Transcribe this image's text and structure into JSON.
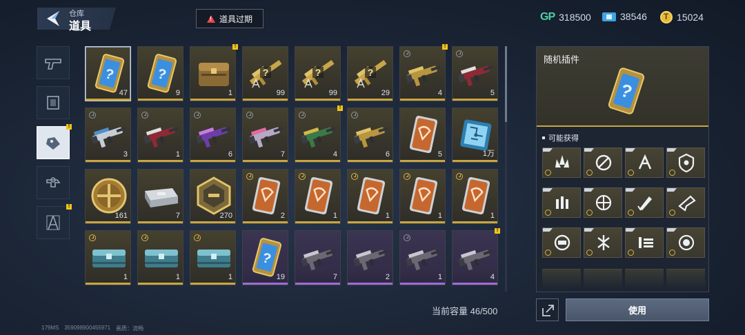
{
  "header": {
    "subtitle": "仓库",
    "title": "道具",
    "expire_label": "道具过期"
  },
  "currency": [
    {
      "icon": "gp-icon",
      "label": "GP",
      "value": "318500"
    },
    {
      "icon": "ticket-icon",
      "value": "38546"
    },
    {
      "icon": "coin-icon",
      "value": "15024"
    }
  ],
  "categories": [
    {
      "name": "weapons",
      "icon": "pistol-icon",
      "active": false,
      "badge": false
    },
    {
      "name": "frames",
      "icon": "frame-icon",
      "active": false,
      "badge": false
    },
    {
      "name": "items",
      "icon": "tag-icon",
      "active": true,
      "badge": true
    },
    {
      "name": "gear",
      "icon": "gear-icon",
      "active": false,
      "badge": false
    },
    {
      "name": "blueprints",
      "icon": "compass-icon",
      "active": false,
      "badge": true
    }
  ],
  "items": [
    {
      "type": "card-question",
      "count": "47",
      "style": "gold",
      "selected": true
    },
    {
      "type": "card-question",
      "count": "9",
      "style": "gold"
    },
    {
      "type": "crate-gold",
      "count": "1",
      "style": "gold",
      "badge": true
    },
    {
      "type": "blueprint-gold",
      "count": "99",
      "style": "gold"
    },
    {
      "type": "blueprint-gold",
      "count": "99",
      "style": "gold"
    },
    {
      "type": "blueprint-gold",
      "count": "29",
      "style": "gold"
    },
    {
      "type": "rifle-gold",
      "count": "4",
      "style": "gold",
      "badge": true,
      "clock": "dim"
    },
    {
      "type": "rifle-red",
      "count": "5",
      "style": "gold",
      "clock": "dim"
    },
    {
      "type": "rifle-white",
      "count": "3",
      "style": "gold",
      "clock": "dim"
    },
    {
      "type": "rifle-red",
      "count": "1",
      "style": "gold",
      "clock": "dim"
    },
    {
      "type": "rifle-purple",
      "count": "6",
      "style": "gold",
      "clock": "dim"
    },
    {
      "type": "rifle-pink",
      "count": "7",
      "style": "gold",
      "clock": "dim"
    },
    {
      "type": "rifle-green",
      "count": "4",
      "style": "gold",
      "badge": true,
      "clock": "dim"
    },
    {
      "type": "rifle-gold",
      "count": "6",
      "style": "gold",
      "clock": "dim"
    },
    {
      "type": "card-orange",
      "count": "5",
      "style": "gold"
    },
    {
      "type": "chip-blue",
      "count": "1万",
      "style": "gold"
    },
    {
      "type": "medal-gold",
      "count": "161",
      "style": "gold"
    },
    {
      "type": "case-silver",
      "count": "7",
      "style": "gold"
    },
    {
      "type": "badge-hex",
      "count": "270",
      "style": "gold"
    },
    {
      "type": "card-orange",
      "count": "2",
      "style": "gold",
      "clock": "gold"
    },
    {
      "type": "card-orange",
      "count": "1",
      "style": "gold",
      "clock": "gold"
    },
    {
      "type": "card-orange",
      "count": "1",
      "style": "gold",
      "clock": "gold"
    },
    {
      "type": "card-orange",
      "count": "1",
      "style": "gold",
      "clock": "gold"
    },
    {
      "type": "card-orange",
      "count": "1",
      "style": "gold",
      "clock": "gold"
    },
    {
      "type": "crate-teal",
      "count": "1",
      "style": "gold",
      "clock": "gold"
    },
    {
      "type": "crate-teal",
      "count": "1",
      "style": "gold",
      "clock": "gold"
    },
    {
      "type": "crate-teal",
      "count": "1",
      "style": "gold",
      "clock": "gold"
    },
    {
      "type": "card-question",
      "count": "19",
      "style": "purple"
    },
    {
      "type": "rifle-dark",
      "count": "7",
      "style": "purple"
    },
    {
      "type": "rifle-dark",
      "count": "2",
      "style": "purple"
    },
    {
      "type": "rifle-dark",
      "count": "1",
      "style": "purple",
      "clock": "dim"
    },
    {
      "type": "rifle-dark",
      "count": "4",
      "style": "purple",
      "badge": true
    }
  ],
  "capacity": "当前容量 46/500",
  "footer": {
    "ping": "179MS",
    "uid": "359098900455971",
    "quality_label": "画质：流畅"
  },
  "detail": {
    "name": "随机插件",
    "obtain_title": "可能获得",
    "plugins": [
      {
        "icon": "spike-plugin-icon"
      },
      {
        "icon": "cross-plugin-icon"
      },
      {
        "icon": "arrow-plugin-icon"
      },
      {
        "icon": "shield-plugin-icon"
      },
      {
        "icon": "bullet-plugin-icon"
      },
      {
        "icon": "target-plugin-icon"
      },
      {
        "icon": "rocket-plugin-icon"
      },
      {
        "icon": "gun-plugin-icon"
      },
      {
        "icon": "loop-plugin-icon"
      },
      {
        "icon": "shatter-plugin-icon"
      },
      {
        "icon": "ammo-plugin-icon"
      },
      {
        "icon": "orb-plugin-icon"
      }
    ]
  },
  "use_label": "使用",
  "colors": {
    "gold_bar": "#c9a640",
    "purple_bar": "#a06ad6",
    "badge": "#f0c31e",
    "gp": "#4fd0a4"
  }
}
